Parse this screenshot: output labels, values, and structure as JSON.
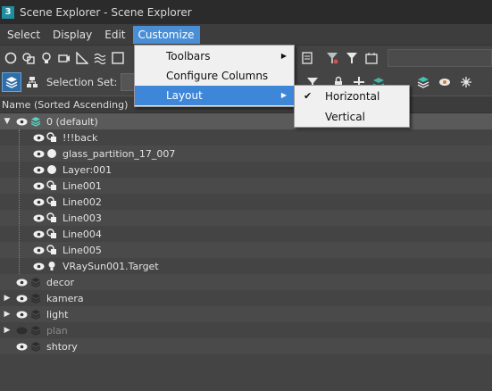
{
  "window": {
    "title": "Scene Explorer - Scene Explorer",
    "logo": "3"
  },
  "menubar": [
    "Select",
    "Display",
    "Edit",
    "Customize"
  ],
  "toolbar": {
    "selection_set_label": "Selection Set:"
  },
  "column_header": "Name (Sorted Ascending)",
  "customize_menu": {
    "items": [
      "Toolbars",
      "Configure Columns",
      "Layout"
    ]
  },
  "layout_submenu": {
    "items": [
      "Horizontal",
      "Vertical"
    ],
    "checked": "Horizontal"
  },
  "tree": {
    "rows": [
      {
        "label": "0 (default)",
        "icon": "layer-icon"
      },
      {
        "label": "!!!back",
        "icon": "shape-icon"
      },
      {
        "label": "glass_partition_17_007",
        "icon": "sphere-icon"
      },
      {
        "label": "Layer:001",
        "icon": "sphere-icon"
      },
      {
        "label": "Line001",
        "icon": "shape-icon"
      },
      {
        "label": "Line002",
        "icon": "shape-icon"
      },
      {
        "label": "Line003",
        "icon": "shape-icon"
      },
      {
        "label": "Line004",
        "icon": "shape-icon"
      },
      {
        "label": "Line005",
        "icon": "shape-icon"
      },
      {
        "label": "VRaySun001.Target",
        "icon": "light-icon"
      },
      {
        "label": "decor",
        "icon": "layer-icon"
      },
      {
        "label": "kamera",
        "icon": "layer-icon"
      },
      {
        "label": "light",
        "icon": "layer-icon"
      },
      {
        "label": "plan",
        "icon": "layer-icon"
      },
      {
        "label": "shtory",
        "icon": "layer-icon"
      }
    ]
  },
  "colors": {
    "accent": "#3e86d8",
    "background": "#444444"
  }
}
